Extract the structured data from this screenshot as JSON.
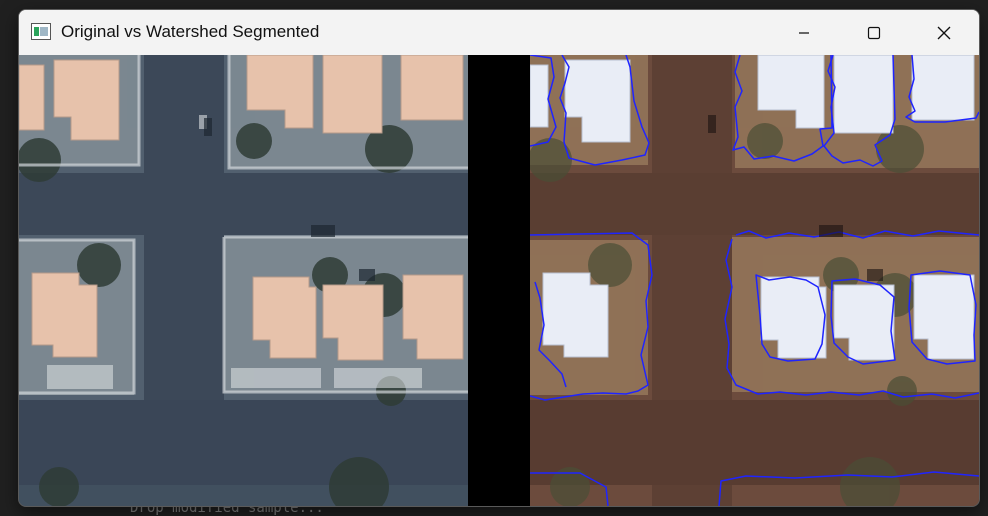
{
  "window": {
    "title": "Original vs Watershed Segmented",
    "controls": [
      "minimize",
      "maximize",
      "close"
    ]
  },
  "background_text": "Drop modified sample...",
  "panels": {
    "original": {
      "name": "original-image"
    },
    "segmented": {
      "name": "watershed-segmented-image"
    }
  },
  "colors": {
    "titlebar": "#f3f3f3",
    "boundary": "#1f24ff",
    "road_original": "#4a5a6c",
    "road_segmented": "#64473b",
    "roof": "#e8c6ad",
    "segmented_roof": "#e9edf6",
    "vegetation": "#3d4c3f"
  },
  "icons": {
    "app": "app-window-icon",
    "minimize": "minimize-icon",
    "maximize": "maximize-icon",
    "close": "close-icon"
  }
}
